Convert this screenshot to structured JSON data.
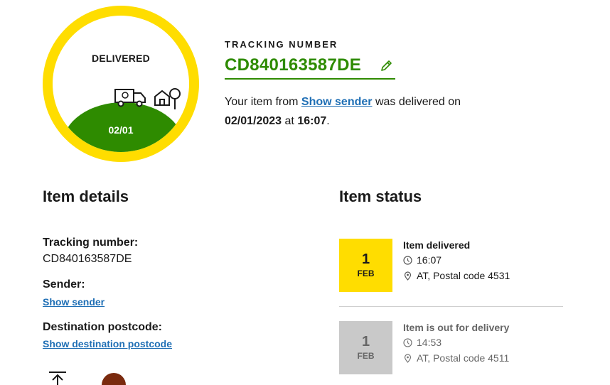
{
  "status_badge": {
    "title": "DELIVERED",
    "date": "02/01",
    "ring_color": "#ffdd00",
    "hill_color": "#2e8b00"
  },
  "tracking": {
    "label": "TRACKING NUMBER",
    "number": "CD840163587DE",
    "accent_color": "#2e8b00"
  },
  "summary": {
    "prefix": "Your item from",
    "sender_link": "Show sender",
    "middle": "was delivered on",
    "date": "02/01/2023",
    "at": "at",
    "time": "16:07",
    "end": "."
  },
  "item_details": {
    "heading": "Item details",
    "tracking_label": "Tracking number:",
    "tracking_value": "CD840163587DE",
    "sender_label": "Sender:",
    "sender_link": "Show sender",
    "postcode_label": "Destination postcode:",
    "postcode_link": "Show destination postcode"
  },
  "item_status": {
    "heading": "Item status",
    "events": [
      {
        "day": "1",
        "month": "FEB",
        "title": "Item delivered",
        "time": "16:07",
        "location": "AT, Postal code 4531",
        "box_color": "#ffdd00"
      },
      {
        "day": "1",
        "month": "FEB",
        "title": "Item is out for delivery",
        "time": "14:53",
        "location": "AT, Postal code 4511",
        "box_color": "#c9c9c9"
      }
    ]
  },
  "icons": [
    "edit-pencil-icon",
    "clock-icon",
    "location-pin-icon",
    "upload-icon",
    "avatar-icon",
    "delivery-truck-icon",
    "house-icon"
  ],
  "link_color": "#1f6fb5"
}
